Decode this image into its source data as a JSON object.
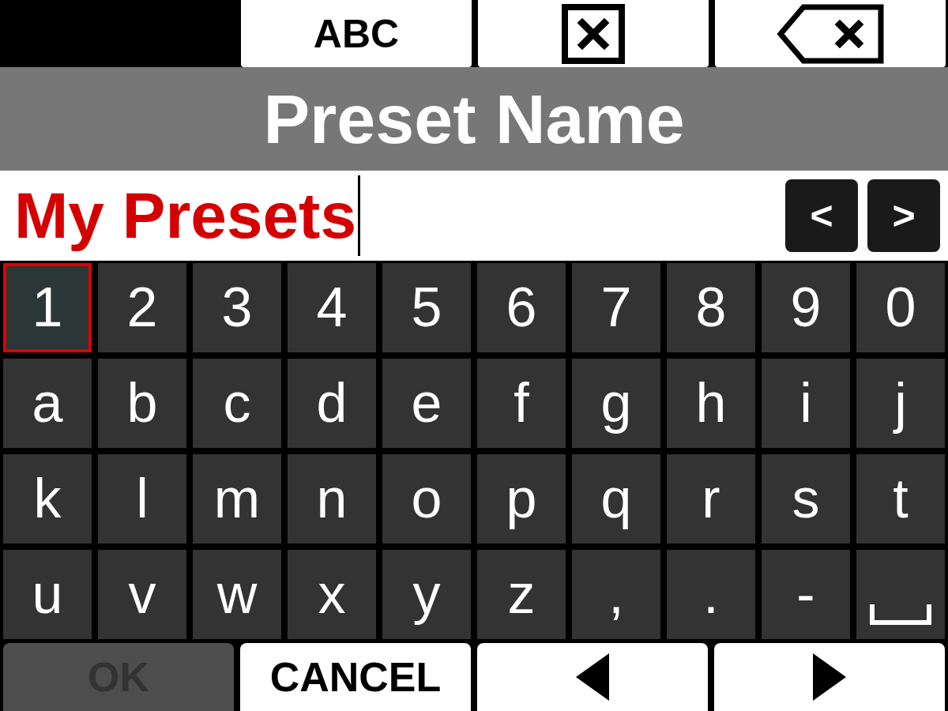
{
  "toolbar": [
    {
      "kind": "mode",
      "label": "ABC"
    },
    {
      "kind": "clear"
    },
    {
      "kind": "backspace"
    }
  ],
  "title": "Preset Name",
  "name_field": {
    "value": "My Presets",
    "nav_buttons": [
      {
        "label": "<"
      },
      {
        "label": ">"
      }
    ]
  },
  "keyboard": {
    "rows": [
      [
        {
          "kind": "char",
          "label": "1",
          "selected": true
        },
        {
          "kind": "char",
          "label": "2",
          "selected": false
        },
        {
          "kind": "char",
          "label": "3",
          "selected": false
        },
        {
          "kind": "char",
          "label": "4",
          "selected": false
        },
        {
          "kind": "char",
          "label": "5",
          "selected": false
        },
        {
          "kind": "char",
          "label": "6",
          "selected": false
        },
        {
          "kind": "char",
          "label": "7",
          "selected": false
        },
        {
          "kind": "char",
          "label": "8",
          "selected": false
        },
        {
          "kind": "char",
          "label": "9",
          "selected": false
        },
        {
          "kind": "char",
          "label": "0",
          "selected": false
        }
      ],
      [
        {
          "kind": "char",
          "label": "a",
          "selected": false
        },
        {
          "kind": "char",
          "label": "b",
          "selected": false
        },
        {
          "kind": "char",
          "label": "c",
          "selected": false
        },
        {
          "kind": "char",
          "label": "d",
          "selected": false
        },
        {
          "kind": "char",
          "label": "e",
          "selected": false
        },
        {
          "kind": "char",
          "label": "f",
          "selected": false
        },
        {
          "kind": "char",
          "label": "g",
          "selected": false
        },
        {
          "kind": "char",
          "label": "h",
          "selected": false
        },
        {
          "kind": "char",
          "label": "i",
          "selected": false
        },
        {
          "kind": "char",
          "label": "j",
          "selected": false
        }
      ],
      [
        {
          "kind": "char",
          "label": "k",
          "selected": false
        },
        {
          "kind": "char",
          "label": "l",
          "selected": false
        },
        {
          "kind": "char",
          "label": "m",
          "selected": false
        },
        {
          "kind": "char",
          "label": "n",
          "selected": false
        },
        {
          "kind": "char",
          "label": "o",
          "selected": false
        },
        {
          "kind": "char",
          "label": "p",
          "selected": false
        },
        {
          "kind": "char",
          "label": "q",
          "selected": false
        },
        {
          "kind": "char",
          "label": "r",
          "selected": false
        },
        {
          "kind": "char",
          "label": "s",
          "selected": false
        },
        {
          "kind": "char",
          "label": "t",
          "selected": false
        }
      ],
      [
        {
          "kind": "char",
          "label": "u",
          "selected": false
        },
        {
          "kind": "char",
          "label": "v",
          "selected": false
        },
        {
          "kind": "char",
          "label": "w",
          "selected": false
        },
        {
          "kind": "char",
          "label": "x",
          "selected": false
        },
        {
          "kind": "char",
          "label": "y",
          "selected": false
        },
        {
          "kind": "char",
          "label": "z",
          "selected": false
        },
        {
          "kind": "char",
          "label": ",",
          "selected": false
        },
        {
          "kind": "char",
          "label": ".",
          "selected": false
        },
        {
          "kind": "char",
          "label": "-",
          "selected": false
        },
        {
          "kind": "space",
          "selected": false
        }
      ]
    ]
  },
  "actions": [
    {
      "kind": "confirm",
      "label": "OK",
      "disabled": true
    },
    {
      "kind": "cancel",
      "label": "CANCEL",
      "disabled": false
    },
    {
      "kind": "cursor_left",
      "disabled": false
    },
    {
      "kind": "cursor_right",
      "disabled": false
    }
  ]
}
